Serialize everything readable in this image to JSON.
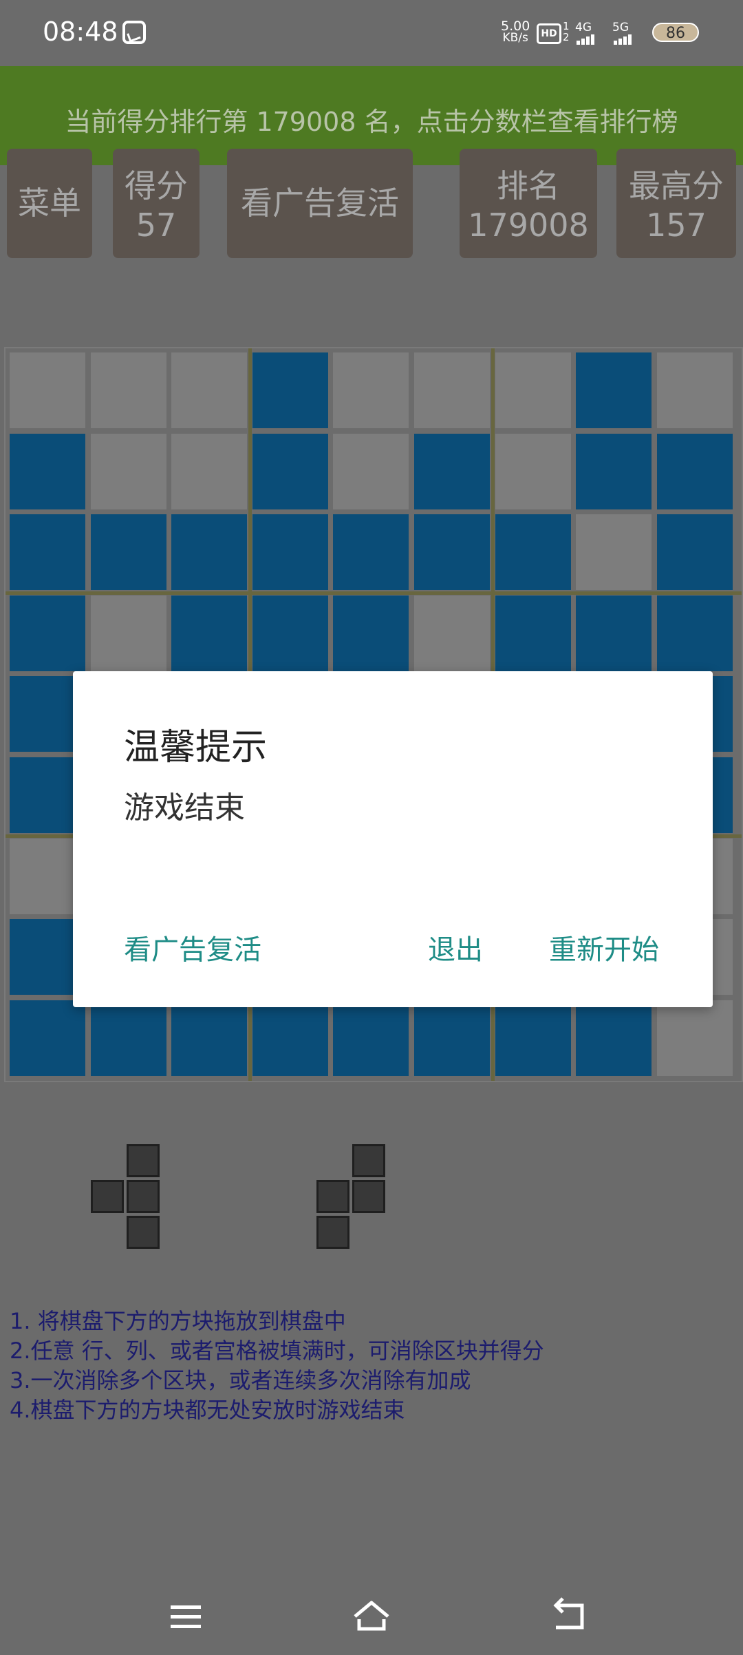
{
  "status_bar": {
    "time": "08:48",
    "net_speed_value": "5.00",
    "net_speed_unit": "KB/s",
    "hd_label": "HD",
    "sim_small": "1\n2",
    "signal1": "4G",
    "signal2": "5G",
    "battery": "86"
  },
  "banner": {
    "text": "当前得分排行第 179008 名，点击分数栏查看排行榜"
  },
  "top_buttons": {
    "menu": "菜单",
    "score_label": "得分",
    "score_value": "57",
    "revive": "看广告复活",
    "rank_label": "排名",
    "rank_value": "179008",
    "best_label": "最高分",
    "best_value": "157"
  },
  "board": {
    "rows": [
      "EEEFEEEFE",
      "FEEFEFEFF",
      "FFFFFFFEF",
      "FEFFFEFFF",
      "FEFFFEFFF",
      "FEFFFEFFF",
      "EEFFFEFFE",
      "FEFFFEFFE",
      "FFFFFFFFE"
    ]
  },
  "dialog": {
    "title": "温馨提示",
    "message": "游戏结束",
    "revive_button": "看广告复活",
    "exit_button": "退出",
    "restart_button": "重新开始"
  },
  "rules": [
    "1. 将棋盘下方的方块拖放到棋盘中",
    "2.任意 行、列、或者宫格被填满时，可消除区块并得分",
    "3.一次消除多个区块，或者连续多次消除有加成",
    "4.棋盘下方的方块都无处安放时游戏结束"
  ],
  "colors": {
    "filled_cell": "#0a4d78",
    "empty_cell": "#7d7d7d",
    "banner": "#4e7a22",
    "dialog_button": "#1e8c86"
  }
}
